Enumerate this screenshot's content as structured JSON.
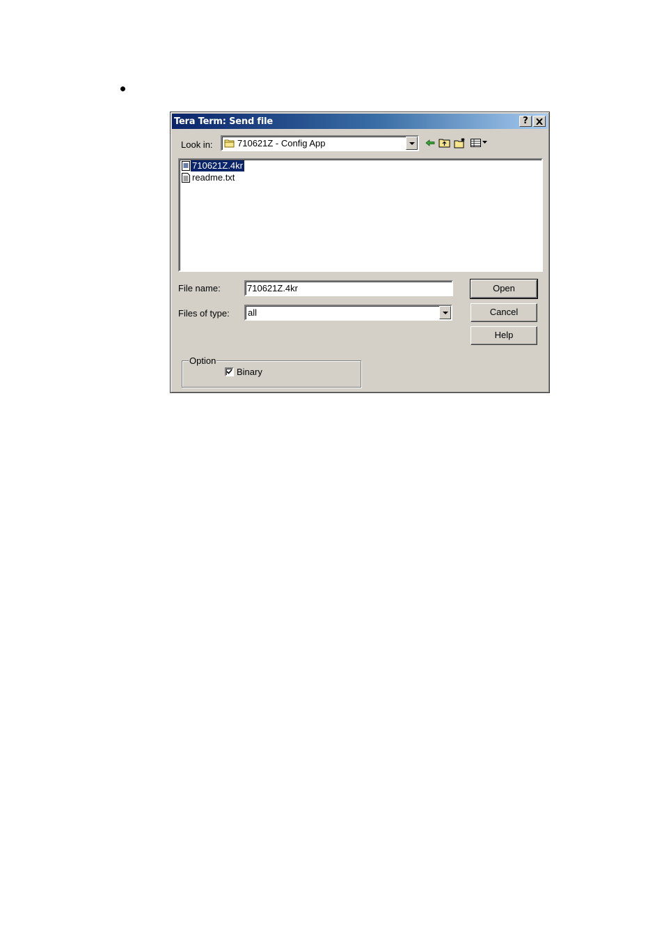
{
  "dialog": {
    "title": "Tera Term: Send file",
    "help_button": "?",
    "close_button": "✕",
    "look_in_label": "Look in:",
    "look_in_value": "710621Z - Config App",
    "files": [
      {
        "name": "710621Z.4kr",
        "selected": true,
        "icon": "app-file-icon"
      },
      {
        "name": "readme.txt",
        "selected": false,
        "icon": "text-file-icon"
      }
    ],
    "file_name_label": "File name:",
    "file_name_value": "710621Z.4kr",
    "files_of_type_label": "Files of type:",
    "files_of_type_value": "all",
    "open_button": "Open",
    "cancel_button": "Cancel",
    "help_label": "Help",
    "option_group_label": "Option",
    "binary_label": "Binary",
    "binary_checked": true
  }
}
